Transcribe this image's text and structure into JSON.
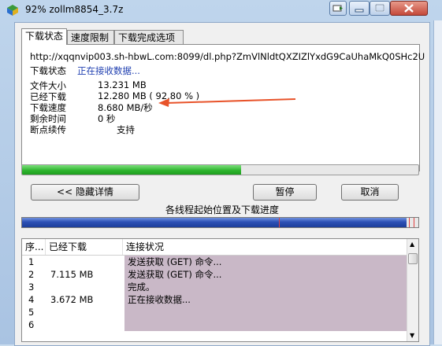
{
  "window": {
    "title": "92% zollm8854_3.7z",
    "icon": "app-icon"
  },
  "tabs": [
    {
      "label": "下载状态",
      "active": true
    },
    {
      "label": "速度限制",
      "active": false
    },
    {
      "label": "下载完成选项",
      "active": false
    }
  ],
  "details": {
    "url": "http://xqqnvip003.sh-hbwL.com:8099/dl.php?ZmVlNldtQXZIZlYxdG9CaUhaMkQ0SHc2U",
    "status_label": "下载状态",
    "status_value": "正在接收数据...",
    "size_label": "文件大小",
    "size_value": "13.231  MB",
    "downloaded_label": "已经下载",
    "downloaded_value": "12.280  MB  ( 92.80 % )",
    "speed_label": "下载速度",
    "speed_value": "8.680  MB/秒",
    "remaining_label": "剩余时间",
    "remaining_value": "0 秒",
    "resume_label": "断点续传",
    "resume_value": "支持"
  },
  "progress": {
    "fraction": 0.552,
    "color": "#2fb52f"
  },
  "buttons": {
    "hide_details": "<< 隐藏详情",
    "pause": "暂停",
    "cancel": "取消"
  },
  "thread_map": {
    "caption": "各线程起始位置及下载进度"
  },
  "table": {
    "headers": [
      "序...",
      "已经下载",
      "连接状况"
    ],
    "rows": [
      {
        "no": "1",
        "downloaded": "",
        "status": "发送获取 (GET) 命令..."
      },
      {
        "no": "2",
        "downloaded": "7.115  MB",
        "status": "发送获取 (GET) 命令..."
      },
      {
        "no": "3",
        "downloaded": "",
        "status": "完成。"
      },
      {
        "no": "4",
        "downloaded": "3.672  MB",
        "status": "正在接收数据..."
      },
      {
        "no": "5",
        "downloaded": "",
        "status": ""
      },
      {
        "no": "6",
        "downloaded": "",
        "status": ""
      }
    ]
  },
  "colors": {
    "annotation_arrow": "#e8532a",
    "status_blue": "#1f3fb0",
    "row_highlight": "#c9b8c7",
    "thread_bar": "#2b4fb5"
  }
}
